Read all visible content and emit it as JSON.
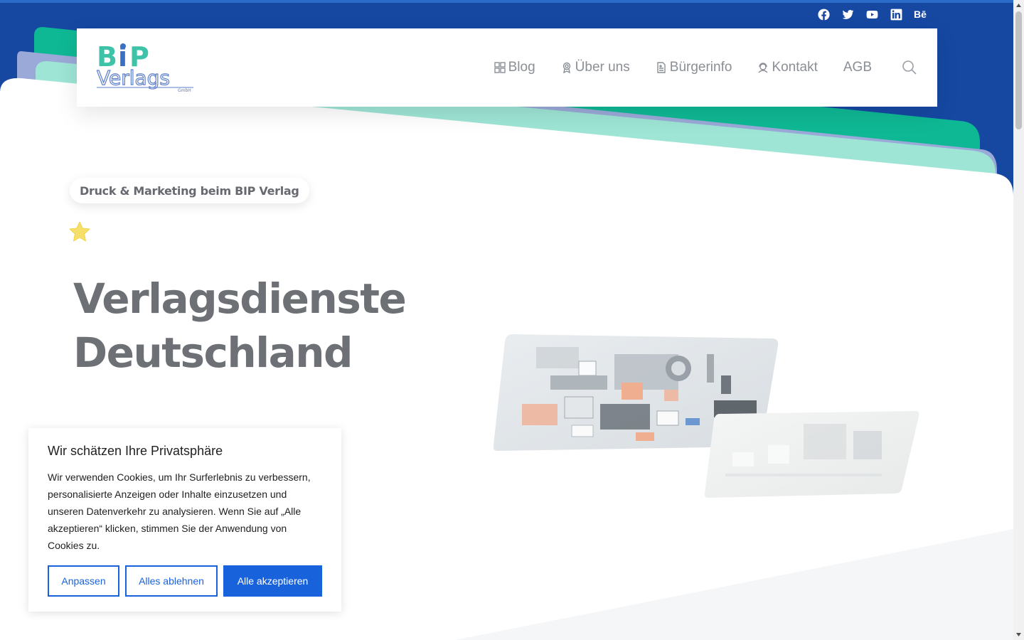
{
  "social": {
    "items": [
      "facebook-icon",
      "twitter-icon",
      "youtube-icon",
      "linkedin-icon",
      "behance-icon"
    ],
    "behance_label": "Bē"
  },
  "logo": {
    "line1": "BiP",
    "line2": "Verlags",
    "line3": "GmbH"
  },
  "nav": {
    "items": [
      {
        "label": "Blog",
        "icon": "grid-icon"
      },
      {
        "label": "Über uns",
        "icon": "award-icon"
      },
      {
        "label": "Bürgerinfo",
        "icon": "document-icon"
      },
      {
        "label": "Kontakt",
        "icon": "support-icon"
      },
      {
        "label": "AGB",
        "icon": ""
      }
    ]
  },
  "hero": {
    "tagline": "Druck & Marketing beim BIP Verlag",
    "title_line1": "Verlagsdienste",
    "title_line2": "Deutschland"
  },
  "cookie": {
    "title": "Wir schätzen Ihre Privatsphäre",
    "text": "Wir verwenden Cookies, um Ihr Surferlebnis zu verbessern, personalisierte Anzeigen oder Inhalte einzusetzen und unseren Datenverkehr zu analysieren. Wenn Sie auf „Alle akzeptieren“ klicken, stimmen Sie der Anwendung von Cookies zu.",
    "btn_customize": "Anpassen",
    "btn_reject": "Alles ablehnen",
    "btn_accept": "Alle akzeptieren"
  },
  "colors": {
    "primary_blue": "#1848a0",
    "teal": "#10b896",
    "cookie_blue": "#1863dc"
  }
}
